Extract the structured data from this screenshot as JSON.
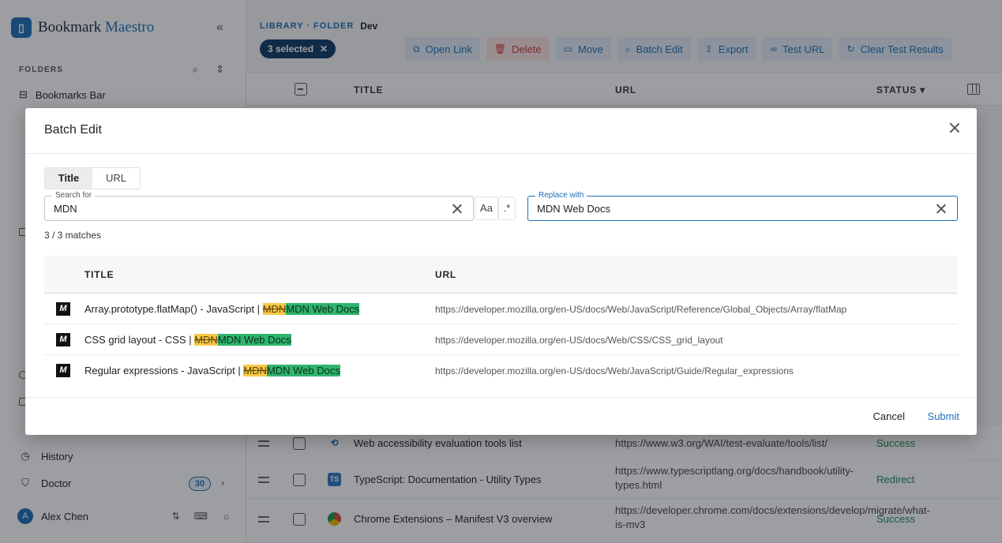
{
  "app": {
    "name_part1": "Bookmark",
    "name_part2": "Maestro"
  },
  "sidebar": {
    "folders_title": "FOLDERS",
    "folders": [
      {
        "label": "Bookmarks Bar"
      }
    ],
    "nav": [
      {
        "label": "History",
        "icon": "history-icon"
      },
      {
        "label": "Doctor",
        "icon": "shield-icon",
        "badge": "30"
      }
    ],
    "user": {
      "name": "Alex Chen",
      "initial": "A"
    }
  },
  "main": {
    "breadcrumb_library": "LIBRARY · FOLDER",
    "breadcrumb_folder": "Dev",
    "selection_label": "3 selected",
    "toolbar": {
      "open_link": "Open Link",
      "delete": "Delete",
      "move": "Move",
      "batch_edit": "Batch Edit",
      "export": "Export",
      "test_url": "Test URL",
      "clear_test_results": "Clear Test Results"
    },
    "columns": {
      "title": "TITLE",
      "url": "URL",
      "status": "STATUS"
    },
    "rows": [
      {
        "title": "Web accessibility evaluation tools list",
        "url": "https://www.w3.org/WAI/test-evaluate/tools/list/",
        "status": "Success",
        "favicon": "w3c-icon"
      },
      {
        "title": "TypeScript: Documentation - Utility Types",
        "url": "https://www.typescriptlang.org/docs/handbook/utility-types.html",
        "status": "Redirect",
        "favicon": "typescript-icon",
        "favicon_text": "TS"
      },
      {
        "title": "Chrome Extensions – Manifest V3 overview",
        "url": "https://developer.chrome.com/docs/extensions/develop/migrate/what-is-mv3",
        "status": "Success",
        "favicon": "chrome-icon"
      }
    ]
  },
  "dialog": {
    "title": "Batch Edit",
    "tabs": [
      {
        "label": "Title",
        "active": true
      },
      {
        "label": "URL",
        "active": false
      }
    ],
    "search": {
      "label": "Search for",
      "value": "MDN"
    },
    "case_option": "Aa",
    "regex_option": ".*",
    "replace": {
      "label": "Replace with",
      "value": "MDN Web Docs"
    },
    "match_count": "3 / 3 matches",
    "preview_columns": {
      "title": "TITLE",
      "url": "URL"
    },
    "preview_rows": [
      {
        "title_prefix": "Array.prototype.flatMap() - JavaScript | ",
        "old": "MDN",
        "new": "MDN Web Docs",
        "url": "https://developer.mozilla.org/en-US/docs/Web/JavaScript/Reference/Global_Objects/Array/flatMap",
        "icon": "M"
      },
      {
        "title_prefix": "CSS grid layout - CSS | ",
        "old": "MDN",
        "new": "MDN Web Docs",
        "url": "https://developer.mozilla.org/en-US/docs/Web/CSS/CSS_grid_layout",
        "icon": "M"
      },
      {
        "title_prefix": "Regular expressions - JavaScript | ",
        "old": "MDN",
        "new": "MDN Web Docs",
        "url": "https://developer.mozilla.org/en-US/docs/Web/JavaScript/Guide/Regular_expressions",
        "icon": "M"
      }
    ],
    "cancel_label": "Cancel",
    "submit_label": "Submit"
  },
  "colors": {
    "accent": "#1d6fb8",
    "success": "#1a8a5a",
    "danger": "#c83a3a",
    "highlight_old": "#f7c948",
    "highlight_new": "#2fb46c"
  }
}
